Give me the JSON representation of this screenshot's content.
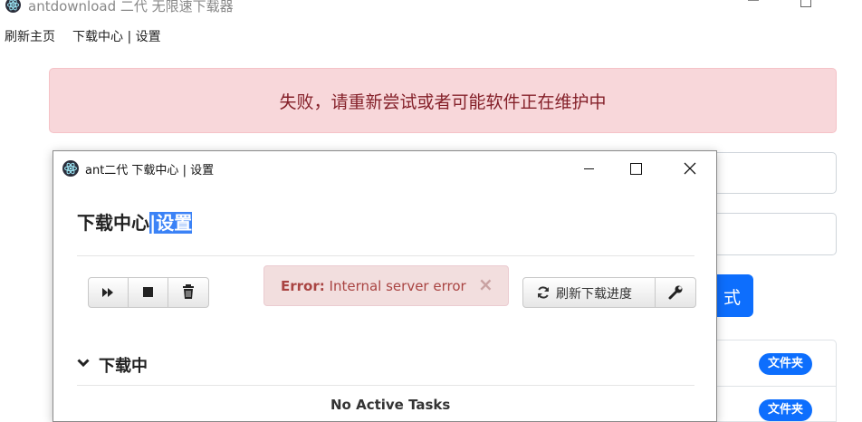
{
  "main_window": {
    "title": "antdownload 二代 无限速下载器",
    "menu": {
      "refresh_home": "刷新主页",
      "download_center": "下载中心 | 设置"
    },
    "error_alert": "失败，请重新尝试或者可能软件正在维护中",
    "submit_button_partial": "式",
    "rows": [
      {
        "folder_badge": "文件夹"
      },
      {
        "folder_badge": "文件夹"
      }
    ]
  },
  "dialog": {
    "title": "ant二代 下载中心 | 设置",
    "heading_prefix": "下载中心",
    "heading_selected": "|设置",
    "server_error": {
      "label": "Error:",
      "message": "Internal server error",
      "close": "×"
    },
    "refresh_button": "刷新下载进度",
    "section_title": "下载中",
    "empty_text": "No Active Tasks"
  },
  "icons": {
    "app_logo": "electron-atom-icon",
    "resume": "fast-forward-icon",
    "stop": "stop-square-icon",
    "delete": "trash-icon",
    "refresh": "refresh-icon",
    "settings": "wrench-icon",
    "chevron": "chevron-down-icon",
    "close": "close-icon"
  },
  "colors": {
    "alert_bg": "#f8d7da",
    "alert_text": "#842029",
    "primary": "#0d6efd",
    "selection": "#3b82f6"
  }
}
